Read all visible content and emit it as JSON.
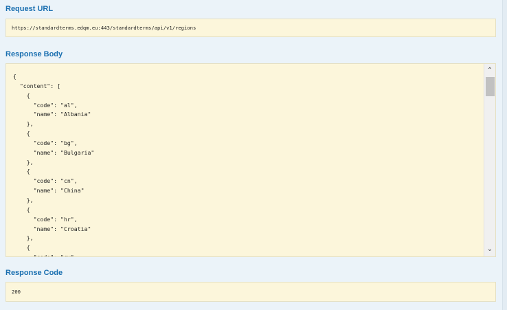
{
  "sections": {
    "request_url": {
      "title": "Request URL",
      "value": "https://standardterms.edqm.eu:443/standardterms/api/v1/regions"
    },
    "response_body": {
      "title": "Response Body",
      "json_text": "{\n  \"content\": [\n    {\n      \"code\": \"al\",\n      \"name\": \"Albania\"\n    },\n    {\n      \"code\": \"bg\",\n      \"name\": \"Bulgaria\"\n    },\n    {\n      \"code\": \"cn\",\n      \"name\": \"China\"\n    },\n    {\n      \"code\": \"hr\",\n      \"name\": \"Croatia\"\n    },\n    {\n      \"code\": \"cy\","
    },
    "response_code": {
      "title": "Response Code",
      "value": "200"
    }
  },
  "scrollbar": {
    "up_icon": "chevron-up-icon",
    "down_icon": "chevron-down-icon",
    "up_glyph": "⌃",
    "down_glyph": "⌄"
  },
  "colors": {
    "title": "#1a6fb0",
    "box_bg": "#fcf6db",
    "page_bg": "#ebf3f9"
  }
}
